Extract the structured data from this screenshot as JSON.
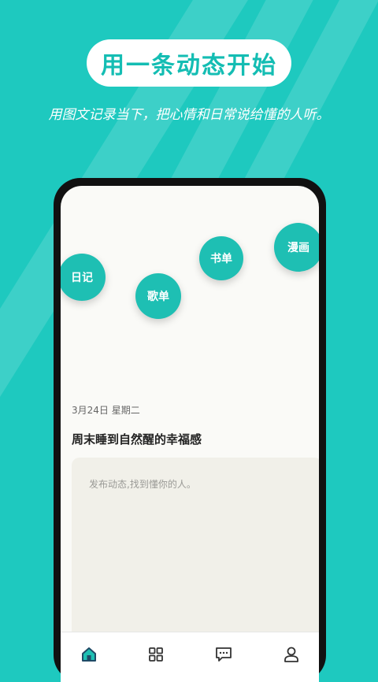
{
  "header": {
    "title": "用一条动态开始",
    "subtitle": "用图文记录当下，把心情和日常说给懂的人听。"
  },
  "categories": [
    {
      "label": "日记"
    },
    {
      "label": "歌单"
    },
    {
      "label": "书单"
    },
    {
      "label": "漫画"
    }
  ],
  "post": {
    "date": "3月24日 星期二",
    "title": "周末睡到自然醒的幸福感",
    "placeholder": "发布动态,找到懂你的人。"
  },
  "tabbar": {
    "items": [
      {
        "icon": "home-icon",
        "active": true
      },
      {
        "icon": "grid-icon",
        "active": false
      },
      {
        "icon": "message-icon",
        "active": false
      },
      {
        "icon": "profile-icon",
        "active": false
      }
    ]
  },
  "colors": {
    "background": "#1ec9bf",
    "accent": "#14bdb3",
    "bubble": "#1ebfb3",
    "composer": "#f1f0e9"
  }
}
